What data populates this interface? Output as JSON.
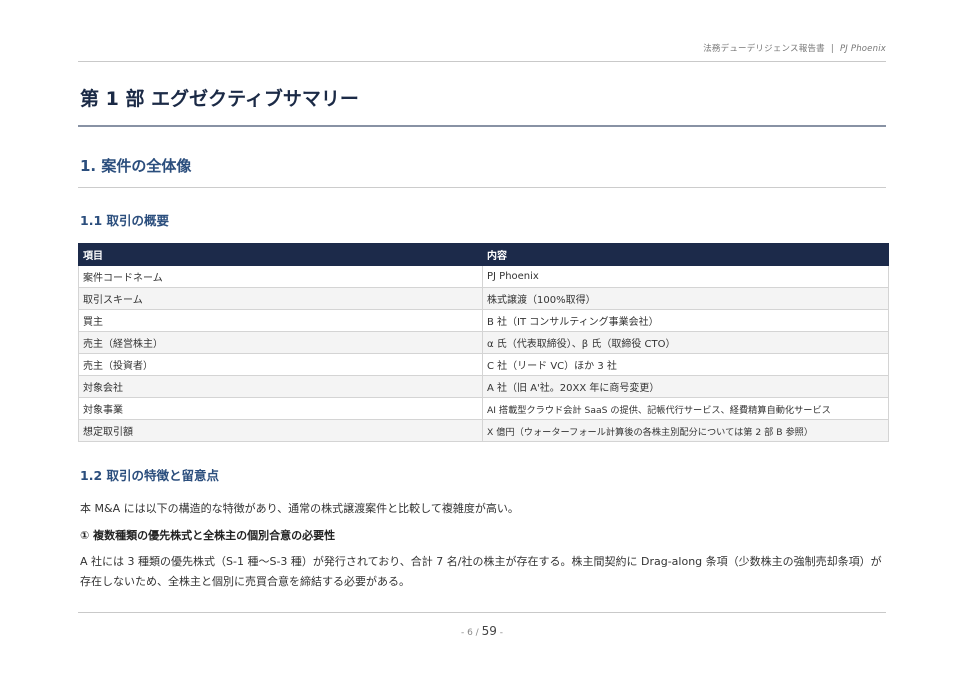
{
  "header": {
    "report_title": "法務デューデリジェンス報告書",
    "separator": "|",
    "project": "PJ Phoenix"
  },
  "part": {
    "title": "第 1 部 エグゼクティブサマリー"
  },
  "section": {
    "title": "1. 案件の全体像"
  },
  "subsection_1": {
    "title": "1.1 取引の概要",
    "table": {
      "headers": [
        "項目",
        "内容"
      ],
      "rows": [
        [
          "案件コードネーム",
          "PJ Phoenix"
        ],
        [
          "取引スキーム",
          "株式譲渡（100%取得）"
        ],
        [
          "買主",
          "B 社（IT コンサルティング事業会社）"
        ],
        [
          "売主（経営株主）",
          "α 氏（代表取締役）、β 氏（取締役 CTO）"
        ],
        [
          "売主（投資者）",
          "C 社（リード VC）ほか 3 社"
        ],
        [
          "対象会社",
          "A 社（旧 A'社。20XX 年に商号変更）"
        ],
        [
          "対象事業",
          "AI 搭載型クラウド会計 SaaS の提供、記帳代行サービス、経費精算自動化サービス"
        ],
        [
          "想定取引額",
          "X 億円（ウォーターフォール計算後の各株主別配分については第 2 部 B 参照）"
        ]
      ]
    }
  },
  "subsection_2": {
    "title": "1.2 取引の特徴と留意点",
    "intro": "本 M&A には以下の構造的な特徴があり、通常の株式譲渡案件と比較して複雑度が高い。",
    "point_1_title": "① 複数種類の優先株式と全株主の個別合意の必要性",
    "point_1_body": "A 社には 3 種類の優先株式（S-1 種〜S-3 種）が発行されており、合計 7 名/社の株主が存在する。株主間契約に Drag-along 条項（少数株主の強制売却条項）が存在しないため、全株主と個別に売買合意を締結する必要がある。"
  },
  "footer": {
    "page_current": "- 6 /",
    "page_total": "59",
    "page_suffix": "-"
  }
}
